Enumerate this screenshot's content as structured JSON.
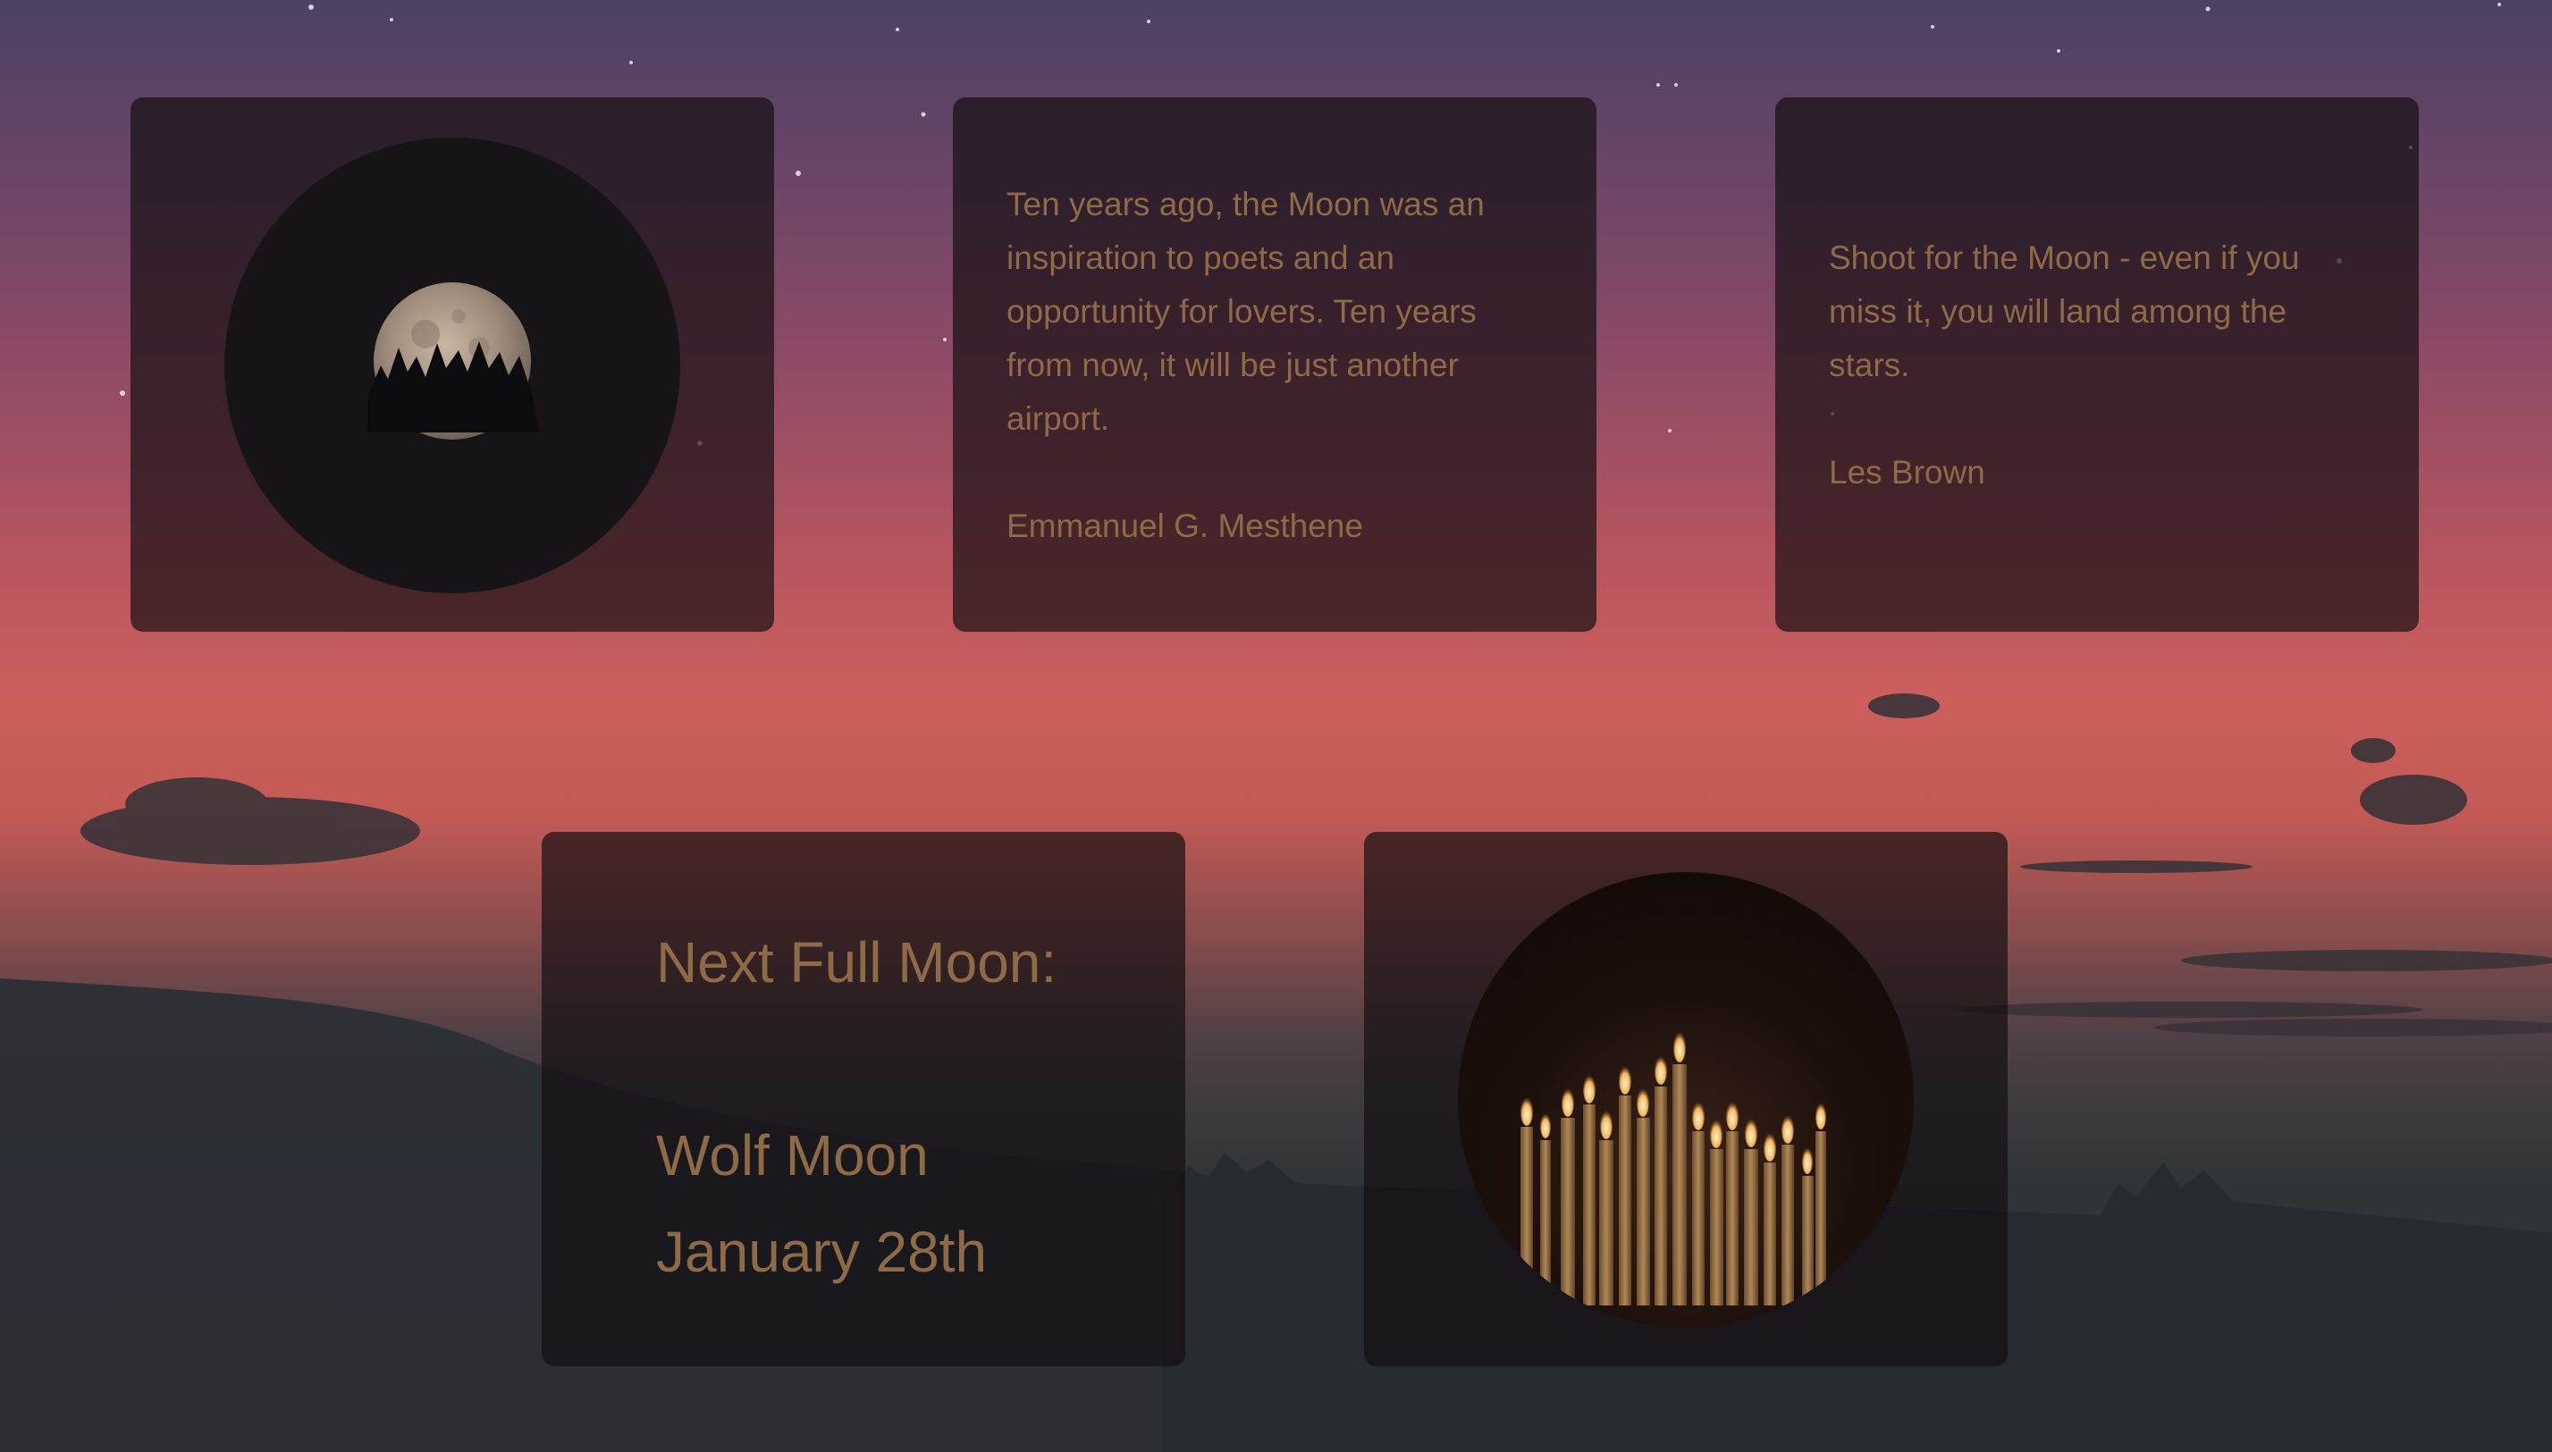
{
  "background": {
    "description_icon": "sunset-sky-background",
    "colors": {
      "sky_top": "#4b4163",
      "sky_mid": "#cc5f5c",
      "ground": "#283036"
    }
  },
  "cards": {
    "moon_photo": {
      "icon": "full-moon-over-trees-image"
    },
    "quote_1": {
      "text": "Ten years ago, the Moon was an inspiration to poets and an opportunity for lovers. Ten years from now, it will be just another airport.",
      "author": "Emmanuel G. Mesthene"
    },
    "quote_2": {
      "text": "Shoot for the Moon - even if you miss it, you will land among the stars.",
      "author": "Les Brown"
    },
    "next_moon": {
      "heading": "Next Full Moon:",
      "name": "Wolf Moon",
      "date": "January 28th"
    },
    "candles_photo": {
      "icon": "lit-candles-image"
    }
  },
  "colors": {
    "text": "#8f6a46",
    "card_bg": "rgba(18,14,16,0.68)"
  }
}
